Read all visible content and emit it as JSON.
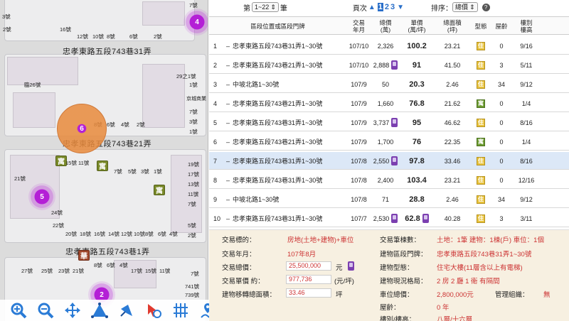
{
  "map": {
    "roads": [
      "忠孝東路五段743巷31弄",
      "忠孝東路五段743巷21弄",
      "忠孝東路五段743巷1弄"
    ],
    "clusters": [
      "4",
      "6",
      "5",
      "2"
    ],
    "pois": [
      "寓",
      "寓",
      "寓",
      "華"
    ],
    "house_numbers": [
      "7號",
      "3號",
      "16號",
      "12號",
      "10號",
      "8號",
      "6號",
      "2號",
      "2號",
      "29之1號",
      "1號",
      "京城商業",
      "臨26號",
      "8號",
      "6號",
      "4號",
      "2號",
      "7號",
      "3號",
      "1號",
      "15號",
      "11號",
      "7號",
      "5號",
      "3號",
      "1號",
      "19號",
      "17號",
      "13號",
      "21號",
      "11號",
      "7號",
      "24號",
      "22號",
      "20號",
      "18號",
      "16號",
      "14號",
      "12號",
      "10號",
      "8號",
      "6號",
      "4號",
      "2號",
      "5號",
      "8號",
      "6號",
      "4號",
      "27號",
      "25號",
      "23號",
      "21號",
      "17號",
      "15號",
      "11號",
      "741號",
      "739號",
      "7號"
    ]
  },
  "toolbar": {
    "tools": [
      "zoom-in",
      "zoom-out",
      "pan",
      "measure-area",
      "select-arrow",
      "pointer-click",
      "grid",
      "route",
      "frame",
      "frame-border",
      "print",
      "pdf"
    ]
  },
  "topbar": {
    "prefix": "第",
    "page_select": "1~22",
    "suffix": "筆",
    "page_label": "頁次",
    "pages": [
      "1",
      "2",
      "3"
    ],
    "sort_label": "排序：",
    "sort_value": "總價"
  },
  "table": {
    "headers": {
      "location": "區段位置或區段門牌",
      "date": "交易\n年月",
      "total": "總價\n(萬)",
      "unit": "單價\n(萬/坪)",
      "area": "總面積\n(坪)",
      "type": "型態",
      "age": "屋齡",
      "floor": "樓別\n樓高"
    },
    "rows": [
      {
        "idx": "1",
        "loc": "忠孝東路五段743巷31弄1~30號",
        "date": "107/10",
        "total": "2,326",
        "park": false,
        "unit": "100.2",
        "area": "23.21",
        "type": "住",
        "age": "0",
        "floor": "9/16"
      },
      {
        "idx": "2",
        "loc": "忠孝東路五段743巷21弄1~30號",
        "date": "107/10",
        "total": "2,888",
        "park": true,
        "unit": "91",
        "area": "41.50",
        "type": "住",
        "age": "3",
        "floor": "5/11"
      },
      {
        "idx": "3",
        "loc": "中坡北路1~30號",
        "date": "107/9",
        "total": "50",
        "park": false,
        "unit": "20.3",
        "area": "2.46",
        "type": "住",
        "age": "34",
        "floor": "9/12"
      },
      {
        "idx": "4",
        "loc": "忠孝東路五段743巷21弄1~30號",
        "date": "107/9",
        "total": "1,660",
        "park": false,
        "unit": "76.8",
        "area": "21.62",
        "type": "寓",
        "age": "0",
        "floor": "1/4"
      },
      {
        "idx": "5",
        "loc": "忠孝東路五段743巷31弄1~30號",
        "date": "107/9",
        "total": "3,737",
        "park": true,
        "unit": "95",
        "area": "46.62",
        "type": "住",
        "age": "0",
        "floor": "8/16"
      },
      {
        "idx": "6",
        "loc": "忠孝東路五段743巷21弄1~30號",
        "date": "107/9",
        "total": "1,700",
        "park": false,
        "unit": "76",
        "area": "22.35",
        "type": "寓",
        "age": "0",
        "floor": "1/4"
      },
      {
        "idx": "7",
        "loc": "忠孝東路五段743巷31弄1~30號",
        "date": "107/8",
        "total": "2,550",
        "park": true,
        "unit": "97.8",
        "area": "33.46",
        "type": "住",
        "age": "0",
        "floor": "8/16"
      },
      {
        "idx": "8",
        "loc": "忠孝東路五段743巷31弄1~30號",
        "date": "107/8",
        "total": "2,400",
        "park": false,
        "unit": "103.4",
        "area": "23.21",
        "type": "住",
        "age": "0",
        "floor": "12/16"
      },
      {
        "idx": "9",
        "loc": "中坡北路1~30號",
        "date": "107/8",
        "total": "71",
        "park": false,
        "unit": "28.8",
        "area": "2.46",
        "type": "住",
        "age": "34",
        "floor": "9/12"
      },
      {
        "idx": "10",
        "loc": "忠孝東路五段743巷31弄1~30號",
        "date": "107/7",
        "total": "2,530",
        "park": true,
        "unit": "62.8",
        "area": "40.28",
        "type": "住",
        "age": "3",
        "floor": "3/11"
      }
    ],
    "highlighted_row": 6
  },
  "detail": {
    "target_label": "交易標的：",
    "target_value": "房地(土地+建物)+車位",
    "date_label": "交易年月：",
    "date_value": "107年8月",
    "total_label": "交易總價：",
    "total_value": "25,500,000",
    "total_unit": "元",
    "unit_label": "交易單價 約：",
    "unit_value": "977,736",
    "unit_unit": "(元/坪)",
    "area_label": "建物移轉總面積：",
    "area_value": "33.46",
    "area_unit": "坪",
    "count_label": "交易筆棟數：",
    "count_value": "土地：1筆 建物：1棟(戶) 車位：1個",
    "addr_label": "建物區段門牌：",
    "addr_value": "忠孝東路五段743巷31弄1~30號",
    "form_label": "建物型態：",
    "form_value": "住宅大樓(11層含以上有電梯)",
    "layout_label": "建物現況格局：",
    "layout_value": "2 房 2 廳 1 衛 有隔間",
    "park_label": "車位總價：",
    "park_value": "2,800,000元",
    "mgmt_label": "管理組織：",
    "mgmt_value": "無",
    "age_label": "屋齡：",
    "age_value": "0  年",
    "floor_label": "樓別/樓高：",
    "floor_value": "八層/十六層"
  }
}
